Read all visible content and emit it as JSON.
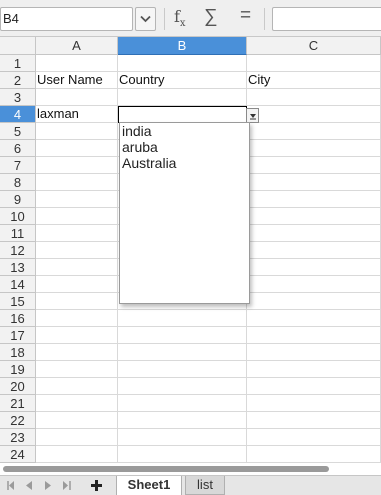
{
  "formula_bar": {
    "name_box_value": "B4",
    "fx_label": "f",
    "fx_sub": "x",
    "sigma_label": "∑",
    "equals_label": "=",
    "formula_value": ""
  },
  "columns": [
    {
      "label": "A"
    },
    {
      "label": "B"
    },
    {
      "label": "C"
    }
  ],
  "active_column": "B",
  "active_row": "4",
  "rows": [
    "1",
    "2",
    "3",
    "4",
    "5",
    "6",
    "7",
    "8",
    "9",
    "10",
    "11",
    "12",
    "13",
    "14",
    "15",
    "16",
    "17",
    "18",
    "19",
    "20",
    "21",
    "22",
    "23",
    "24"
  ],
  "cells": {
    "A2": "User Name",
    "B2": "Country",
    "C2": "City",
    "A4": "laxman",
    "B4": ""
  },
  "dropdown": {
    "items": [
      "india",
      "aruba",
      "Australia"
    ]
  },
  "sheets": {
    "active": "Sheet1",
    "other": "list"
  },
  "colors": {
    "selection_accent": "#4a90d9",
    "header_bg": "#f2f2f2"
  }
}
